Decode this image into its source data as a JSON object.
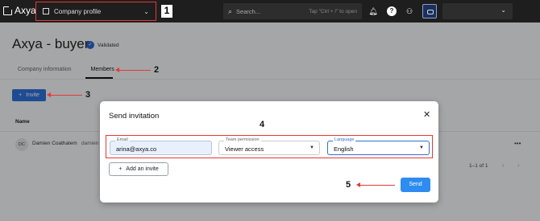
{
  "topbar": {
    "logo": "Axya",
    "company_select": "Company profile",
    "search_placeholder": "Search...",
    "search_hint": "Tap \"Ctrl + /\" to open"
  },
  "page": {
    "title": "Axya - buyer",
    "validated": "Validated",
    "tabs": [
      "Company information",
      "Members"
    ],
    "invite_label": "Invite",
    "column_name": "Name",
    "member": {
      "initials": "DC",
      "name": "Damien Coathalem",
      "email_partial": "damien"
    },
    "pagination": "1–1 of 1"
  },
  "modal": {
    "title": "Send invitation",
    "email_label": "Email",
    "email_value": "arina@axya.co",
    "permission_label": "Team permission",
    "permission_value": "Viewer access",
    "language_label": "Language",
    "language_value": "English",
    "add_invite": "Add an invite",
    "send": "Send"
  },
  "annotations": [
    "1",
    "2",
    "3",
    "4",
    "5"
  ],
  "colors": {
    "primary": "#2e6fd9",
    "send": "#2e8cf0",
    "annotation": "#e53935",
    "topbar": "#1e1e1e"
  }
}
